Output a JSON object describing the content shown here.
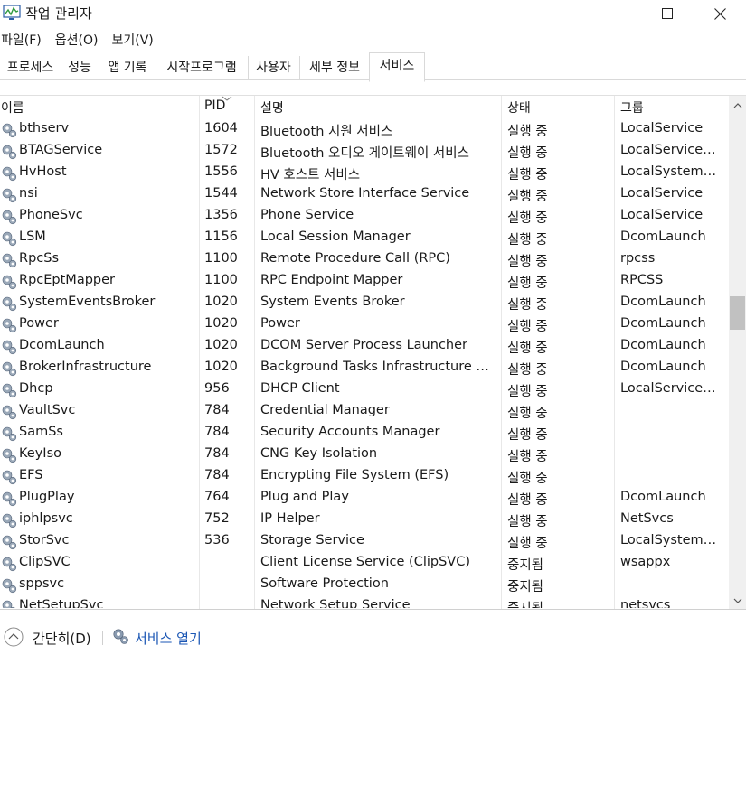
{
  "window": {
    "title": "작업 관리자"
  },
  "menu": [
    "파일(F)",
    "옵션(O)",
    "보기(V)"
  ],
  "tabs": [
    {
      "label": "프로세스",
      "active": false
    },
    {
      "label": "성능",
      "active": false
    },
    {
      "label": "앱 기록",
      "active": false
    },
    {
      "label": "시작프로그램",
      "active": false
    },
    {
      "label": "사용자",
      "active": false
    },
    {
      "label": "세부 정보",
      "active": false
    },
    {
      "label": "서비스",
      "active": true
    }
  ],
  "columns": {
    "name": "이름",
    "pid": "PID",
    "desc": "설명",
    "state": "상태",
    "group": "그룹"
  },
  "rows": [
    {
      "name": "bthserv",
      "pid": "1604",
      "desc": "Bluetooth 지원 서비스",
      "state": "실행 중",
      "group": "LocalService"
    },
    {
      "name": "BTAGService",
      "pid": "1572",
      "desc": "Bluetooth 오디오 게이트웨이 서비스",
      "state": "실행 중",
      "group": "LocalServiceNe..."
    },
    {
      "name": "HvHost",
      "pid": "1556",
      "desc": "HV 호스트 서비스",
      "state": "실행 중",
      "group": "LocalSystemNe..."
    },
    {
      "name": "nsi",
      "pid": "1544",
      "desc": "Network Store Interface Service",
      "state": "실행 중",
      "group": "LocalService"
    },
    {
      "name": "PhoneSvc",
      "pid": "1356",
      "desc": "Phone Service",
      "state": "실행 중",
      "group": "LocalService"
    },
    {
      "name": "LSM",
      "pid": "1156",
      "desc": "Local Session Manager",
      "state": "실행 중",
      "group": "DcomLaunch"
    },
    {
      "name": "RpcSs",
      "pid": "1100",
      "desc": "Remote Procedure Call (RPC)",
      "state": "실행 중",
      "group": "rpcss"
    },
    {
      "name": "RpcEptMapper",
      "pid": "1100",
      "desc": "RPC Endpoint Mapper",
      "state": "실행 중",
      "group": "RPCSS"
    },
    {
      "name": "SystemEventsBroker",
      "pid": "1020",
      "desc": "System Events Broker",
      "state": "실행 중",
      "group": "DcomLaunch"
    },
    {
      "name": "Power",
      "pid": "1020",
      "desc": "Power",
      "state": "실행 중",
      "group": "DcomLaunch"
    },
    {
      "name": "DcomLaunch",
      "pid": "1020",
      "desc": "DCOM Server Process Launcher",
      "state": "실행 중",
      "group": "DcomLaunch"
    },
    {
      "name": "BrokerInfrastructure",
      "pid": "1020",
      "desc": "Background Tasks Infrastructure Ser...",
      "state": "실행 중",
      "group": "DcomLaunch"
    },
    {
      "name": "Dhcp",
      "pid": "956",
      "desc": "DHCP Client",
      "state": "실행 중",
      "group": "LocalServiceNe..."
    },
    {
      "name": "VaultSvc",
      "pid": "784",
      "desc": "Credential Manager",
      "state": "실행 중",
      "group": ""
    },
    {
      "name": "SamSs",
      "pid": "784",
      "desc": "Security Accounts Manager",
      "state": "실행 중",
      "group": ""
    },
    {
      "name": "KeyIso",
      "pid": "784",
      "desc": "CNG Key Isolation",
      "state": "실행 중",
      "group": ""
    },
    {
      "name": "EFS",
      "pid": "784",
      "desc": "Encrypting File System (EFS)",
      "state": "실행 중",
      "group": ""
    },
    {
      "name": "PlugPlay",
      "pid": "764",
      "desc": "Plug and Play",
      "state": "실행 중",
      "group": "DcomLaunch"
    },
    {
      "name": "iphlpsvc",
      "pid": "752",
      "desc": "IP Helper",
      "state": "실행 중",
      "group": "NetSvcs"
    },
    {
      "name": "StorSvc",
      "pid": "536",
      "desc": "Storage Service",
      "state": "실행 중",
      "group": "LocalSystemNe..."
    },
    {
      "name": "ClipSVC",
      "pid": "",
      "desc": "Client License Service (ClipSVC)",
      "state": "중지됨",
      "group": "wsappx"
    },
    {
      "name": "sppsvc",
      "pid": "",
      "desc": "Software Protection",
      "state": "중지됨",
      "group": ""
    },
    {
      "name": "NetSetupSvc",
      "pid": "",
      "desc": "Network Setup Service",
      "state": "중지됨",
      "group": "netsvcs"
    }
  ],
  "footer": {
    "fewer_details": "간단히(D)",
    "open_services": "서비스 열기"
  },
  "colors": {
    "link": "#1a56b4",
    "scroll_thumb": "#c1c1c1"
  },
  "icons": {
    "app": "task-manager-icon",
    "service": "gear-icon",
    "footer_toggle": "chevron-up-circle-icon"
  }
}
